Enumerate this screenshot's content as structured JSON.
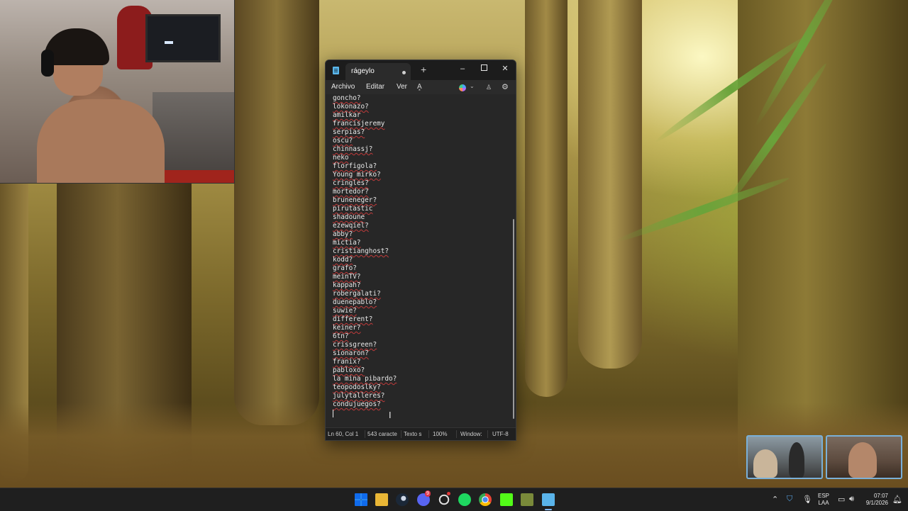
{
  "notepad": {
    "tab_title": "rágeylo",
    "new_tab_symbol": "+",
    "window_controls": {
      "minimize": "–",
      "close": "✕"
    },
    "menu": {
      "archivo": "Archivo",
      "editar": "Editar",
      "ver": "Ver",
      "format_symbol": "A͓"
    },
    "lines": [
      "goncho?",
      "lokonazo?",
      "amilkar",
      "francisjeremy",
      "serpias?",
      "oscu?",
      "chinnassj?",
      "neko",
      "florfigola?",
      "Young mirko?",
      "cringles?",
      "mortedor?",
      "bruneneger?",
      "pirutastic",
      "shadoune",
      "ezewqiel?",
      "abby?",
      "mictia?",
      "cristianghost?",
      "kodd?",
      "grafo?",
      "meinTV?",
      "kappah?",
      "robergalati?",
      "duenepablo?",
      "suwie?",
      "different?",
      "keiner?",
      "6tn?",
      "crissgreen?",
      "sionaron?",
      "franix?",
      "pabloxo?",
      "la mina pibardo?",
      "teopodoslky?",
      "julytalleres?",
      "condujuegos?"
    ],
    "status": {
      "position": "Ln 60, Col 1",
      "characters": "543 caracte",
      "type": "Texto s",
      "zoom": "100%",
      "line_ending": "Window:",
      "encoding": "UTF-8"
    }
  },
  "taskbar": {
    "language": "ESP",
    "language_sub": "LAA",
    "time": "07:07",
    "date": "9/1/2026",
    "apps": [
      "start",
      "file-explorer",
      "steam",
      "discord",
      "obs",
      "spotify",
      "chrome",
      "kick",
      "game-app",
      "notepad"
    ],
    "discord_badge": "9"
  },
  "colors": {
    "accent": "#7fb9ff",
    "spellcheck_underline": "#c03a3a",
    "taskbar_bg": "#1f1f1f"
  }
}
